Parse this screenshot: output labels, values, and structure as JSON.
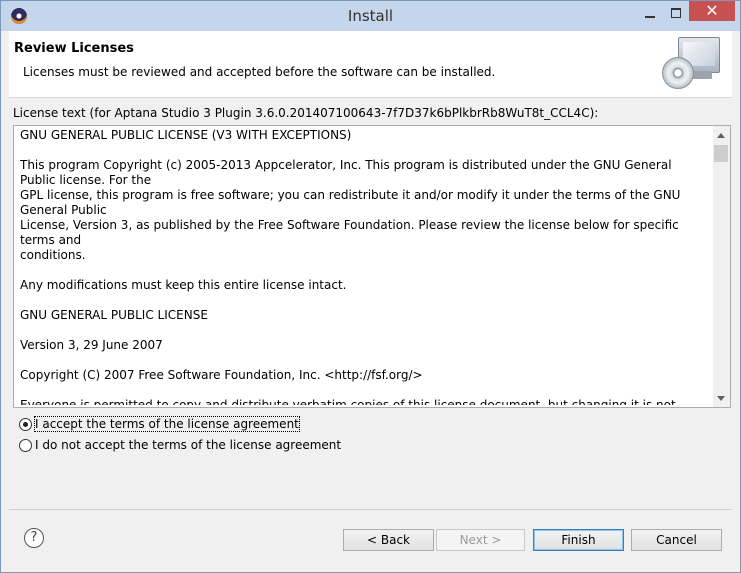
{
  "window": {
    "title": "Install",
    "close_symbol": "✕"
  },
  "header": {
    "title": "Review Licenses",
    "description": "Licenses must be reviewed and accepted before the software can be installed."
  },
  "license": {
    "label": "License text (for Aptana Studio 3 Plugin 3.6.0.201407100643-7f7D37k6bPlkbrRb8WuT8t_CCL4C):",
    "paragraphs": [
      "GNU GENERAL PUBLIC LICENSE (V3 WITH EXCEPTIONS)",
      "This program Copyright (c) 2005-2013 Appcelerator, Inc. This program is distributed under the GNU General Public license. For the\nGPL license, this program is free software; you can redistribute it and/or modify it under the terms of the GNU General Public\nLicense, Version 3, as published by the Free Software Foundation. Please review the license below for specific terms and\nconditions.",
      "Any modifications must keep this entire license intact.",
      "GNU GENERAL PUBLIC LICENSE",
      "Version 3, 29 June 2007",
      "Copyright (C) 2007 Free Software Foundation, Inc. <http://fsf.org/>",
      "Everyone is permitted to copy and distribute verbatim copies of this license document, but changing it is not allowed.\nPreamble"
    ]
  },
  "options": {
    "accept_label": "I accept the terms of the license agreement",
    "decline_label": "I do not accept the terms of the license agreement",
    "selected": "accept"
  },
  "buttons": {
    "help": "?",
    "back": "< Back",
    "next": "Next >",
    "finish": "Finish",
    "cancel": "Cancel"
  }
}
